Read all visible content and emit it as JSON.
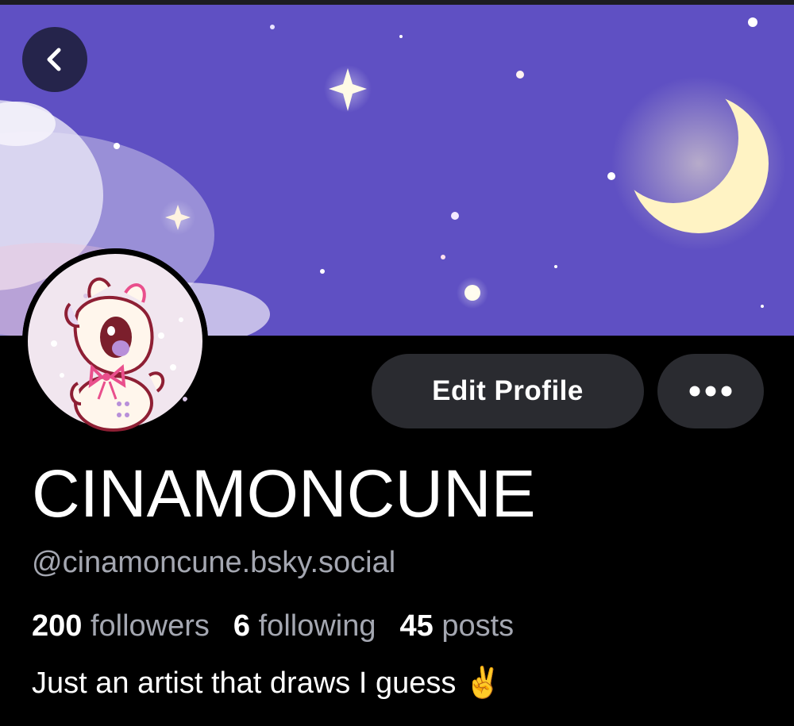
{
  "header": {
    "back_icon": "chevron-left-icon",
    "banner_description_colors": {
      "sky": "#5c4fc0",
      "moon": "#fff4c9"
    }
  },
  "actions": {
    "edit_profile_label": "Edit Profile",
    "more_icon": "ellipsis-icon"
  },
  "profile": {
    "display_name": "CINAMONCUNE",
    "handle": "@cinamoncune.bsky.social",
    "stats": {
      "followers_count": "200",
      "followers_label": "followers",
      "following_count": "6",
      "following_label": "following",
      "posts_count": "45",
      "posts_label": "posts"
    },
    "bio": "Just an artist that draws I guess ✌️"
  },
  "theme": {
    "background": "#000000",
    "button_bg": "#2a2b30",
    "muted_text": "#a4a7b1"
  }
}
